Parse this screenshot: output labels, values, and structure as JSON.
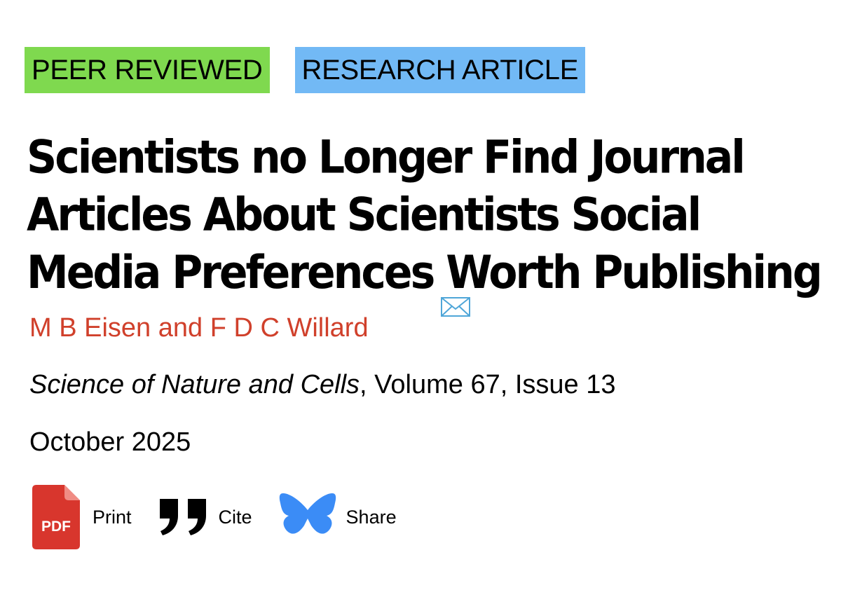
{
  "tags": {
    "peer_reviewed": "PEER REVIEWED",
    "research_article": "RESEARCH ARTICLE",
    "peer_color": "#7fd94f",
    "research_color": "#72b9f5"
  },
  "article": {
    "title": "Scientists no Longer Find Journal Articles About Scientists Social Media Preferences Worth Publishing",
    "authors": "M B Eisen and F D C Willard",
    "author_color": "#d0402b",
    "journal": "Science of Nature and Cells",
    "volume_issue": ", Volume 67, Issue 13",
    "date": "October 2025"
  },
  "actions": {
    "print_label": "Print",
    "pdf_badge": "PDF",
    "cite_label": "Cite",
    "share_label": "Share",
    "print_icon": "pdf-icon",
    "cite_icon": "quote-icon",
    "share_icon": "butterfly-icon"
  }
}
